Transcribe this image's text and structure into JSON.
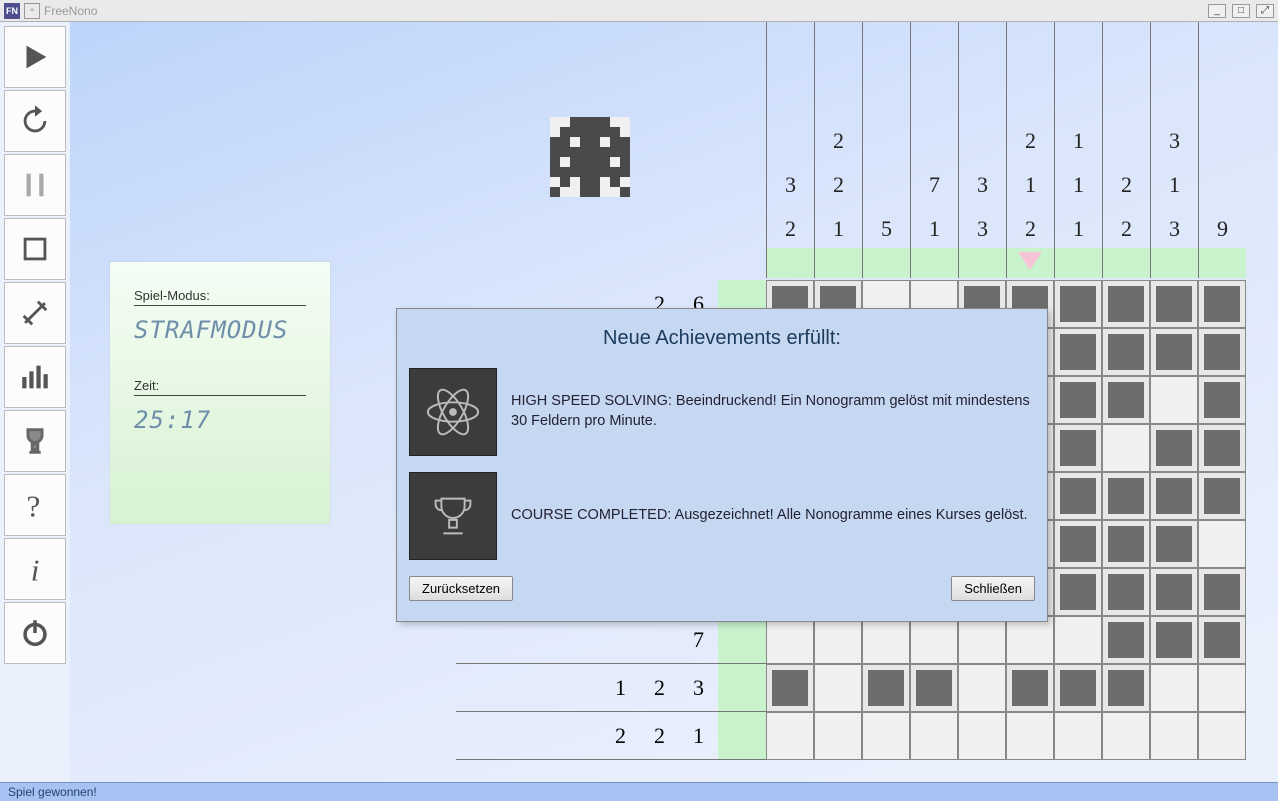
{
  "window": {
    "title": "FreeNono"
  },
  "window_controls": {
    "minimize": "_",
    "maximize": "□",
    "close": "⤢"
  },
  "toolbar": {
    "play": "play-icon",
    "restart": "restart-icon",
    "pause": "pause-icon",
    "stop": "stop-icon",
    "settings": "settings-icon",
    "stats": "stats-icon",
    "trophy": "trophy-icon",
    "help": "help-icon",
    "info": "info-icon",
    "power": "power-icon"
  },
  "info": {
    "mode_label": "Spiel-Modus:",
    "mode_value": "STRAFMODUS",
    "time_label": "Zeit:",
    "time_value": "25:17"
  },
  "puzzle": {
    "col_hints": [
      [
        "3",
        "2"
      ],
      [
        "2",
        "2",
        "1"
      ],
      [
        "5"
      ],
      [
        "7",
        "1"
      ],
      [
        "3",
        "3"
      ],
      [
        "2",
        "1",
        "2"
      ],
      [
        "1",
        "1",
        "1"
      ],
      [
        "2",
        "2"
      ],
      [
        "3",
        "1",
        "3"
      ],
      [
        "9"
      ]
    ],
    "row_hints": [
      [
        "2",
        "6"
      ],
      [],
      [],
      [],
      [],
      [],
      [],
      [
        "7"
      ],
      [
        "1",
        "2",
        "3"
      ],
      [
        "2",
        "2",
        "1"
      ]
    ],
    "marker_col": 5
  },
  "dialog": {
    "title": "Neue Achievements erfüllt:",
    "items": [
      {
        "icon": "atom",
        "text": "HIGH SPEED SOLVING: Beeindruckend! Ein Nonogramm gelöst mit mindestens 30 Feldern pro Minute."
      },
      {
        "icon": "cup",
        "text": "COURSE COMPLETED: Ausgezeichnet! Alle Nonogramme eines Kurses gelöst."
      }
    ],
    "reset": "Zurücksetzen",
    "close": "Schließen"
  },
  "status": "Spiel gewonnen!"
}
